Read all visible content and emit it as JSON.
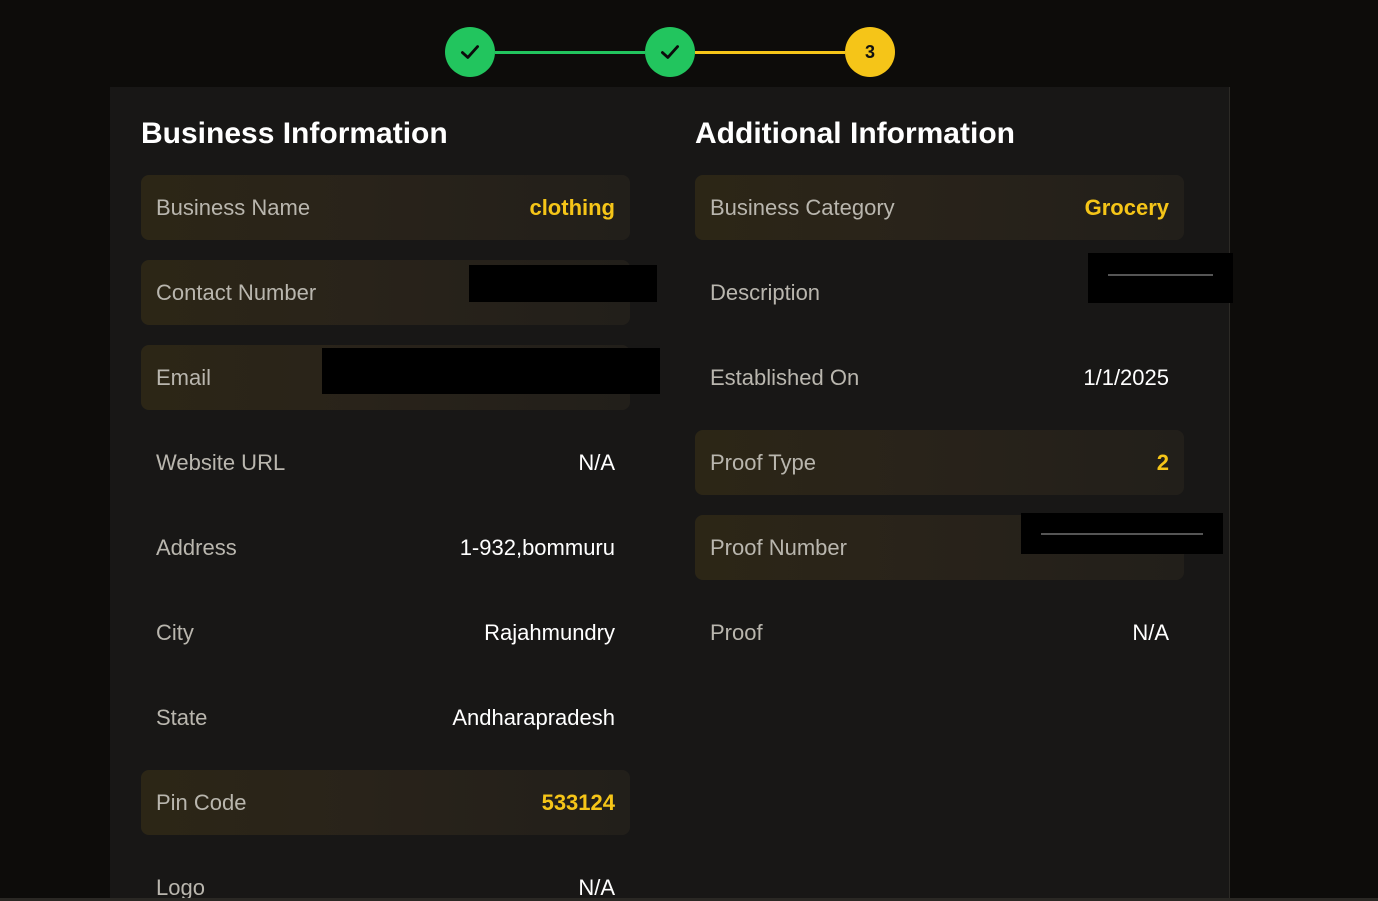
{
  "stepper": {
    "steps": [
      {
        "state": "done",
        "icon": "check-icon"
      },
      {
        "state": "done",
        "icon": "check-icon"
      },
      {
        "state": "current",
        "label": "3"
      }
    ],
    "colors": {
      "done": "#22c55e",
      "current": "#f5c518"
    }
  },
  "business": {
    "title": "Business Information",
    "rows": [
      {
        "label": "Business Name",
        "value": "clothing",
        "highlight": true
      },
      {
        "label": "Contact Number",
        "value": "",
        "highlight": true,
        "redacted": true
      },
      {
        "label": "Email",
        "value": "",
        "highlight": true,
        "redacted": true
      },
      {
        "label": "Website URL",
        "value": "N/A",
        "highlight": false
      },
      {
        "label": "Address",
        "value": "1-932,bommuru",
        "highlight": false
      },
      {
        "label": "City",
        "value": "Rajahmundry",
        "highlight": false
      },
      {
        "label": "State",
        "value": "Andharapradesh",
        "highlight": false
      },
      {
        "label": "Pin Code",
        "value": "533124",
        "highlight": true
      },
      {
        "label": "Logo",
        "value": "N/A",
        "highlight": false
      }
    ]
  },
  "additional": {
    "title": "Additional Information",
    "rows": [
      {
        "label": "Business Category",
        "value": "Grocery",
        "highlight": true
      },
      {
        "label": "Description",
        "value": "",
        "highlight": false,
        "redacted": true
      },
      {
        "label": "Established On",
        "value": "1/1/2025",
        "highlight": false
      },
      {
        "label": "Proof Type",
        "value": "2",
        "highlight": true
      },
      {
        "label": "Proof Number",
        "value": "",
        "highlight": true,
        "redacted": true
      },
      {
        "label": "Proof",
        "value": "N/A",
        "highlight": false
      }
    ]
  },
  "colors": {
    "background": "#0d0c0a",
    "card": "#181716",
    "accent": "#f5c518",
    "success": "#22c55e"
  }
}
